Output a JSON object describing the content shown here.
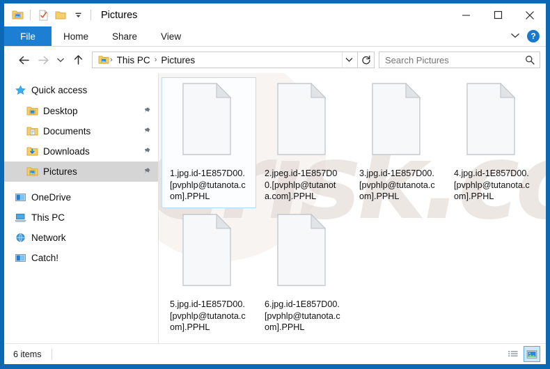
{
  "window": {
    "title": "Pictures",
    "quick_access_toolbar": [
      {
        "name": "pictures-folder-icon",
        "label": "Pictures folder"
      },
      {
        "name": "properties-icon",
        "label": "Properties"
      },
      {
        "name": "new-folder-icon",
        "label": "New folder"
      },
      {
        "name": "customize-qat-chevron-icon",
        "label": "Customize Quick Access Toolbar"
      }
    ],
    "controls": {
      "minimize": "Minimize",
      "maximize": "Maximize",
      "close": "Close"
    },
    "frame_color": "#0b68b5"
  },
  "ribbon": {
    "tabs": [
      {
        "label": "File",
        "active": true
      },
      {
        "label": "Home",
        "active": false
      },
      {
        "label": "Share",
        "active": false
      },
      {
        "label": "View",
        "active": false
      }
    ],
    "expand_label": "Expand the Ribbon",
    "help_label": "?",
    "accent_color": "#1d7fd4"
  },
  "navbar": {
    "back_label": "Back",
    "forward_label": "Forward",
    "recent_label": "Recent locations",
    "up_label": "Up",
    "breadcrumb": {
      "icon": "pictures-folder-icon",
      "items": [
        "This PC",
        "Pictures"
      ],
      "separator": "›",
      "dropdown_label": "Previous locations"
    },
    "refresh_label": "Refresh",
    "search": {
      "placeholder": "Search Pictures",
      "value": ""
    }
  },
  "sidebar": {
    "groups": [
      {
        "name": "quick-access",
        "label": "Quick access",
        "icon": "star-icon",
        "items": [
          {
            "label": "Desktop",
            "icon": "folder-desktop-icon",
            "pinned": true,
            "selected": false
          },
          {
            "label": "Documents",
            "icon": "folder-documents-icon",
            "pinned": true,
            "selected": false
          },
          {
            "label": "Downloads",
            "icon": "folder-downloads-icon",
            "pinned": true,
            "selected": false
          },
          {
            "label": "Pictures",
            "icon": "folder-pictures-icon",
            "pinned": true,
            "selected": true
          }
        ]
      }
    ],
    "roots": [
      {
        "label": "OneDrive",
        "icon": "onedrive-icon"
      },
      {
        "label": "This PC",
        "icon": "this-pc-icon"
      },
      {
        "label": "Network",
        "icon": "network-icon"
      },
      {
        "label": "Catch!",
        "icon": "catch-drive-icon"
      }
    ]
  },
  "content": {
    "watermark": "PCrisk.com",
    "files": [
      {
        "name": "1.jpg.id-1E857D00.[pvphlp@tutanota.com].PPHL",
        "icon": "blank-file-icon",
        "selected": true
      },
      {
        "name": "2.jpeg.id-1E857D00.[pvphlp@tutanota.com].PPHL",
        "icon": "blank-file-icon",
        "selected": false
      },
      {
        "name": "3.jpg.id-1E857D00.[pvphlp@tutanota.com].PPHL",
        "icon": "blank-file-icon",
        "selected": false
      },
      {
        "name": "4.jpg.id-1E857D00.[pvphlp@tutanota.com].PPHL",
        "icon": "blank-file-icon",
        "selected": false
      },
      {
        "name": "5.jpg.id-1E857D00.[pvphlp@tutanota.com].PPHL",
        "icon": "blank-file-icon",
        "selected": false
      },
      {
        "name": "6.jpg.id-1E857D00.[pvphlp@tutanota.com].PPHL",
        "icon": "blank-file-icon",
        "selected": false
      }
    ]
  },
  "statusbar": {
    "item_count": "6 items",
    "views": [
      {
        "name": "details-view-button",
        "label": "Details view",
        "active": false
      },
      {
        "name": "large-icons-view-button",
        "label": "Large icons view",
        "active": true
      }
    ]
  }
}
